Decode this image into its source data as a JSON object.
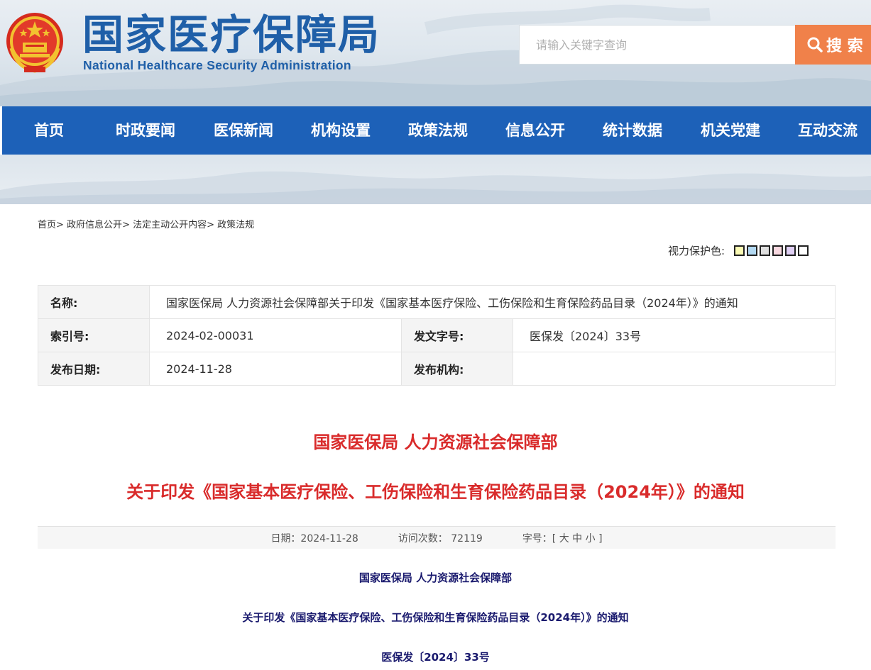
{
  "header": {
    "title_cn": "国家医疗保障局",
    "title_en": "National Healthcare Security Administration",
    "search_placeholder": "请输入关键字查询",
    "search_button": "搜 索"
  },
  "nav": [
    "首页",
    "时政要闻",
    "医保新闻",
    "机构设置",
    "政策法规",
    "信息公开",
    "统计数据",
    "机关党建",
    "互动交流"
  ],
  "breadcrumb": [
    "首页",
    "政府信息公开",
    "法定主动公开内容",
    "政策法规"
  ],
  "eye_care": {
    "label": "视力保护色:",
    "colors": [
      "#fafab4",
      "#b3d9f2",
      "#e0e0e0",
      "#f8d8e0",
      "#e0d0f4",
      "#ffffff"
    ]
  },
  "info": {
    "name_label": "名称:",
    "name_value": "国家医保局 人力资源社会保障部关于印发《国家基本医疗保险、工伤保险和生育保险药品目录（2024年）》的通知",
    "index_label": "索引号:",
    "index_value": "2024-02-00031",
    "doc_no_label": "发文字号:",
    "doc_no_value": "医保发〔2024〕33号",
    "date_label": "发布日期:",
    "date_value": "2024-11-28",
    "org_label": "发布机构:",
    "org_value": ""
  },
  "article": {
    "title_line1": "国家医保局 人力资源社会保障部",
    "title_line2": "关于印发《国家基本医疗保险、工伤保险和生育保险药品目录（2024年）》的通知",
    "meta_date": "日期：2024-11-28",
    "meta_views": "访问次数：  72119",
    "meta_fontsize": "字号：[ 大 中 小 ]",
    "body_line1": "国家医保局 人力资源社会保障部",
    "body_line2": "关于印发《国家基本医疗保险、工伤保险和生育保险药品目录（2024年）》的通知",
    "body_line3": "医保发〔2024〕33号"
  }
}
